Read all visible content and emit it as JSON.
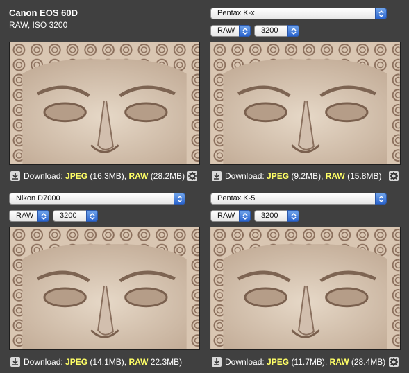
{
  "panels": [
    {
      "camera": "Canon EOS 60D",
      "subtitle": "RAW, ISO 3200",
      "download_label": "Download:",
      "jpeg_label": "JPEG",
      "jpeg_size": "(16.3MB),",
      "raw_label": "RAW",
      "raw_size": "(28.2MB)"
    },
    {
      "camera": "Pentax K-x",
      "format": "RAW",
      "iso": "3200",
      "download_label": "Download:",
      "jpeg_label": "JPEG",
      "jpeg_size": "(9.2MB),",
      "raw_label": "RAW",
      "raw_size": "(15.8MB)"
    },
    {
      "camera": "Nikon D7000",
      "format": "RAW",
      "iso": "3200",
      "download_label": "Download:",
      "jpeg_label": "JPEG",
      "jpeg_size": "(14.1MB),",
      "raw_label": "RAW",
      "raw_size": "22.3MB)"
    },
    {
      "camera": "Pentax K-5",
      "format": "RAW",
      "iso": "3200",
      "download_label": "Download:",
      "jpeg_label": "JPEG",
      "jpeg_size": "(11.7MB),",
      "raw_label": "RAW",
      "raw_size": "(28.4MB)"
    }
  ],
  "colors": {
    "background": "#404040",
    "link_highlight": "#ffff66",
    "select_arrow": "#2c66cf"
  },
  "icons": [
    "download-icon",
    "gear-icon",
    "select-arrows-icon"
  ]
}
